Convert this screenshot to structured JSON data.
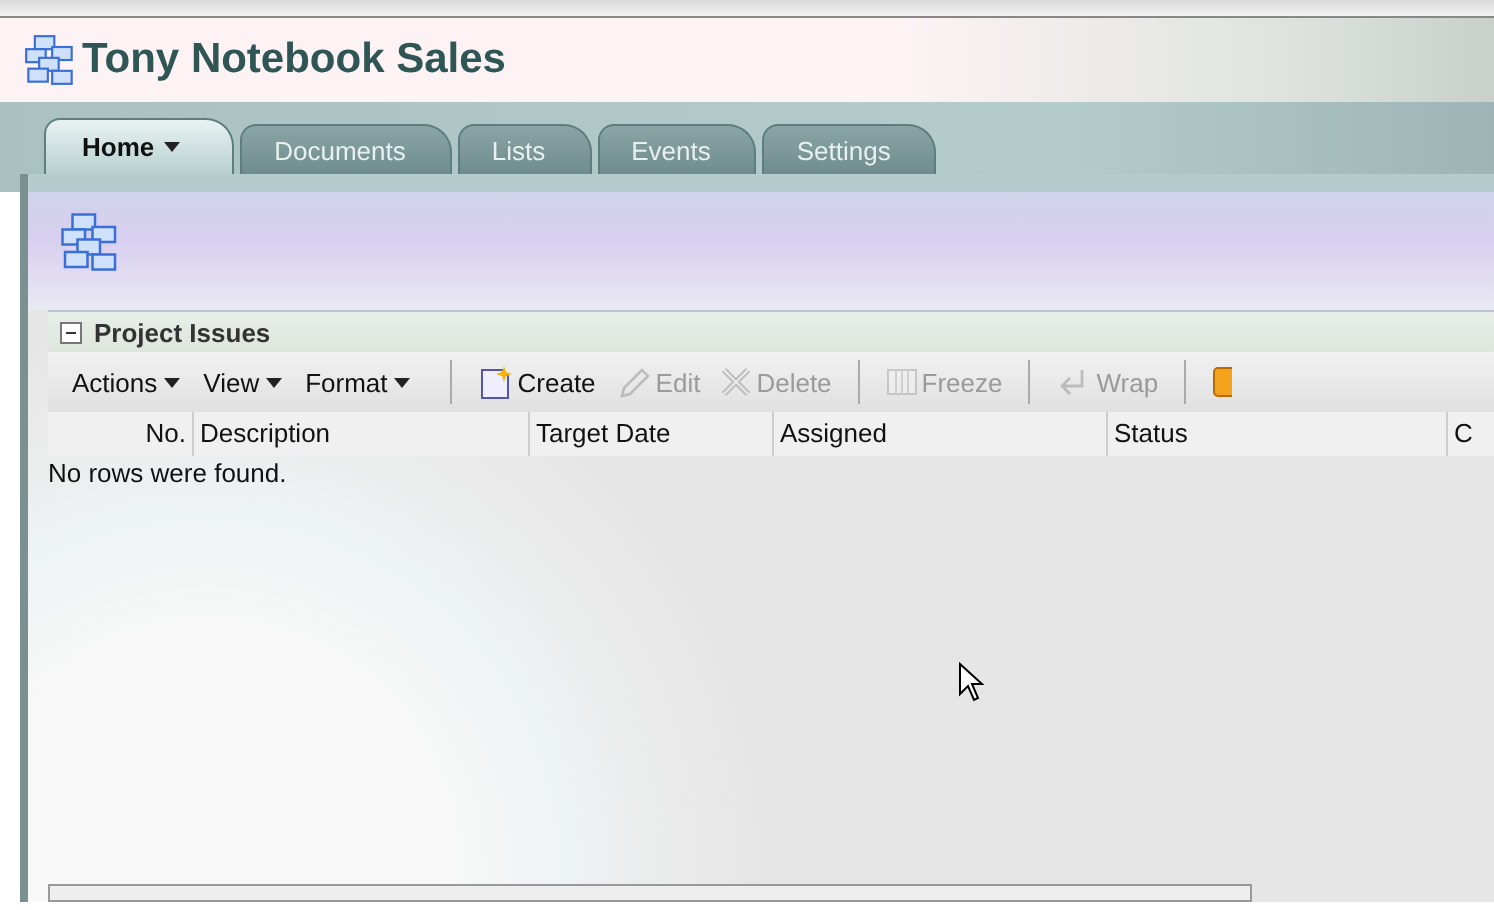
{
  "site": {
    "title": "Tony Notebook Sales"
  },
  "tabs": [
    {
      "label": "Home",
      "selected": true
    },
    {
      "label": "Documents",
      "selected": false
    },
    {
      "label": "Lists",
      "selected": false
    },
    {
      "label": "Events",
      "selected": false
    },
    {
      "label": "Settings",
      "selected": false
    }
  ],
  "panel": {
    "title": "Project Issues",
    "expanded": true,
    "toolbar": [
      {
        "kind": "menu",
        "label": "Actions"
      },
      {
        "kind": "menu",
        "label": "View"
      },
      {
        "kind": "menu",
        "label": "Format"
      },
      {
        "kind": "separator"
      },
      {
        "kind": "button",
        "label": "Create",
        "disabled": false
      },
      {
        "kind": "button",
        "label": "Edit",
        "disabled": true
      },
      {
        "kind": "button",
        "label": "Delete",
        "disabled": true
      },
      {
        "kind": "separator"
      },
      {
        "kind": "button",
        "label": "Freeze",
        "disabled": true
      },
      {
        "kind": "separator"
      },
      {
        "kind": "button",
        "label": "Wrap",
        "disabled": true
      },
      {
        "kind": "separator"
      },
      {
        "kind": "button",
        "disabled": false
      }
    ],
    "table": {
      "columns": [
        {
          "label": "No."
        },
        {
          "label": "Description"
        },
        {
          "label": "Target Date"
        },
        {
          "label": "Assigned"
        },
        {
          "label": "Status"
        },
        {
          "label": "C"
        }
      ],
      "empty_message": "No rows were found."
    }
  }
}
